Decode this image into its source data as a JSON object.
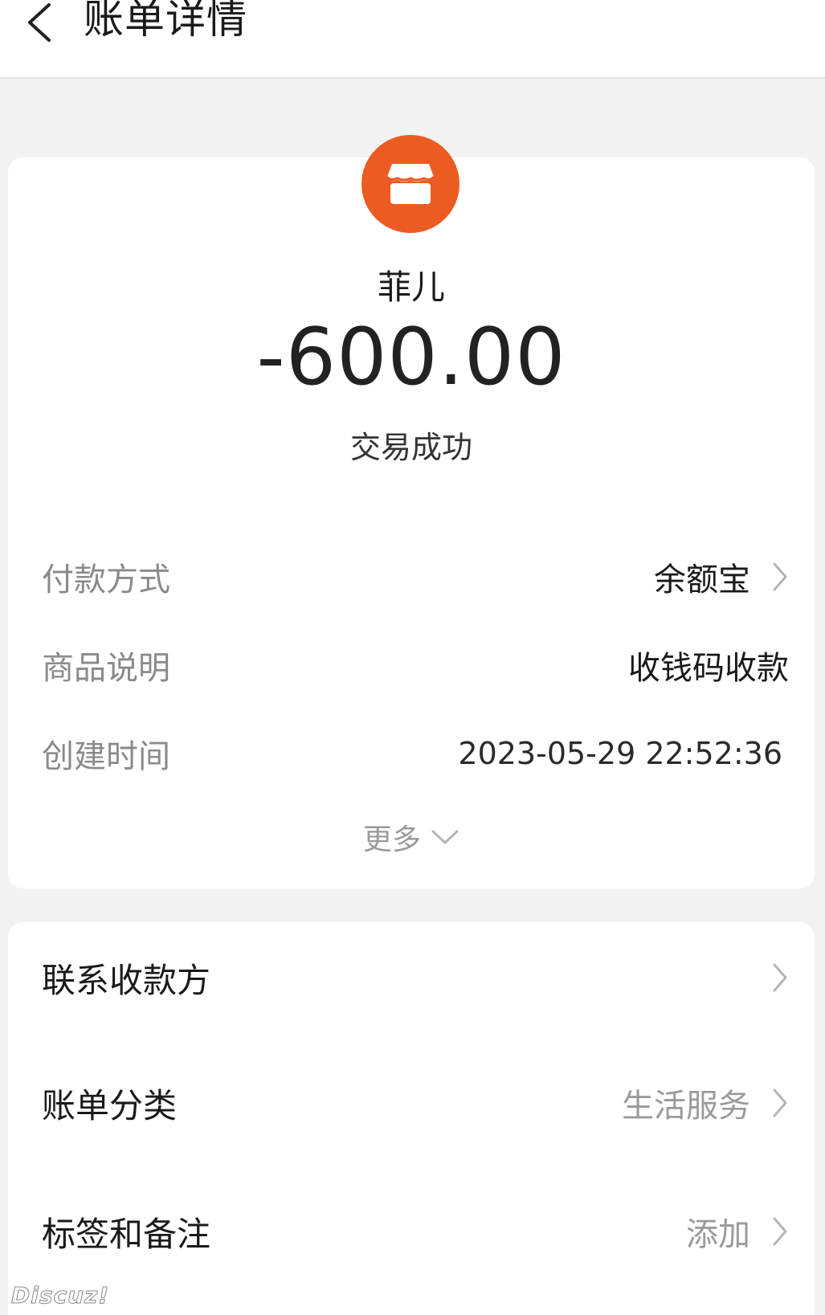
{
  "header": {
    "title": "账单详情"
  },
  "summary": {
    "merchant_name": "菲儿",
    "amount": "-600.00",
    "status": "交易成功",
    "avatar_color": "#ec5b22",
    "avatar_icon": "store-icon"
  },
  "details": [
    {
      "label": "付款方式",
      "value": "余额宝",
      "has_chevron": true
    },
    {
      "label": "商品说明",
      "value": "收钱码收款",
      "has_chevron": false
    },
    {
      "label": "创建时间",
      "value": "2023-05-29 22:52:36",
      "has_chevron": false
    }
  ],
  "more": {
    "label": "更多"
  },
  "actions": [
    {
      "label": "联系收款方",
      "value": ""
    },
    {
      "label": "账单分类",
      "value": "生活服务"
    },
    {
      "label": "标签和备注",
      "value": "添加"
    }
  ],
  "watermark": "Discuz!"
}
